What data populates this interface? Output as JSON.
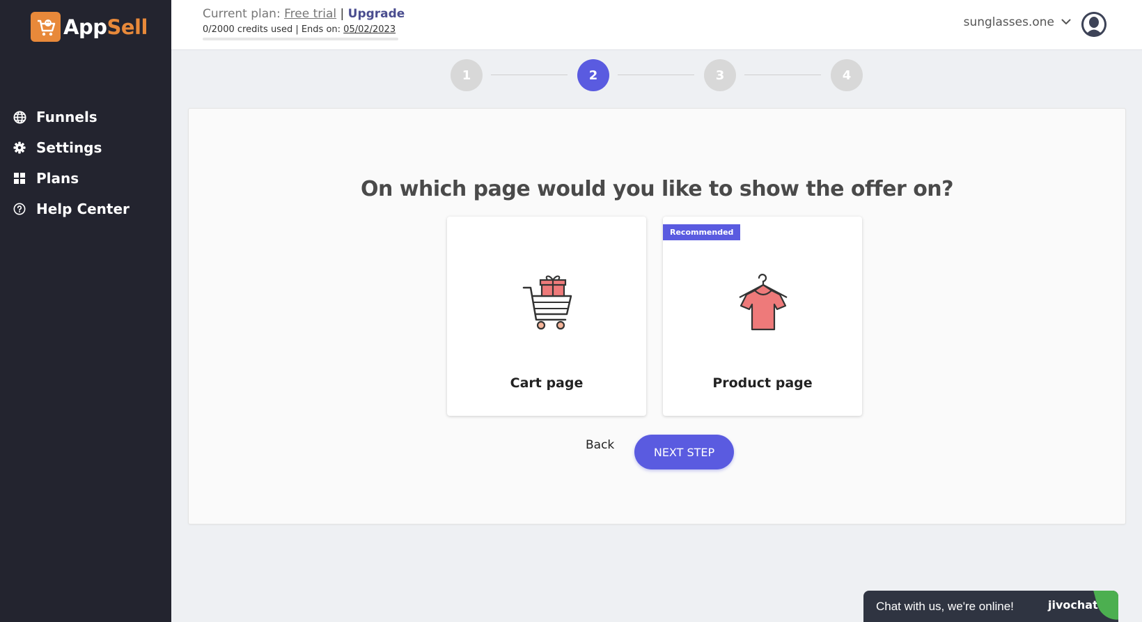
{
  "app": {
    "name_part1": "App",
    "name_part2": "Sell"
  },
  "sidebar": {
    "items": [
      {
        "label": "Funnels",
        "icon": "globe-icon"
      },
      {
        "label": "Settings",
        "icon": "gear-icon"
      },
      {
        "label": "Plans",
        "icon": "grid-icon"
      },
      {
        "label": "Help Center",
        "icon": "help-circle-icon"
      }
    ]
  },
  "header": {
    "plan_prefix": "Current plan:",
    "plan_name": "Free trial",
    "plan_separator": "|",
    "upgrade_label": "Upgrade",
    "credits_text": "0/2000 credits used | Ends on:",
    "end_date": "05/02/2023",
    "credits_used_fraction": 0,
    "store_name": "sunglasses.one"
  },
  "stepper": {
    "steps": [
      "1",
      "2",
      "3",
      "4"
    ],
    "active_step": 2
  },
  "main": {
    "question": "On which page would you like to show the offer on?",
    "options": [
      {
        "label": "Cart page",
        "icon": "shopping-cart-gift-icon"
      },
      {
        "label": "Product page",
        "icon": "tshirt-hanger-icon",
        "badge": "Recommended"
      }
    ],
    "back_label": "Back",
    "next_label": "NEXT STEP"
  },
  "chat": {
    "text": "Chat with us, we're online!",
    "brand": "jivochat"
  },
  "colors": {
    "sidebar_bg": "#23242f",
    "accent": "#5a5be0",
    "brand_orange": "#e8893a",
    "tshirt": "#ee7a7a"
  }
}
